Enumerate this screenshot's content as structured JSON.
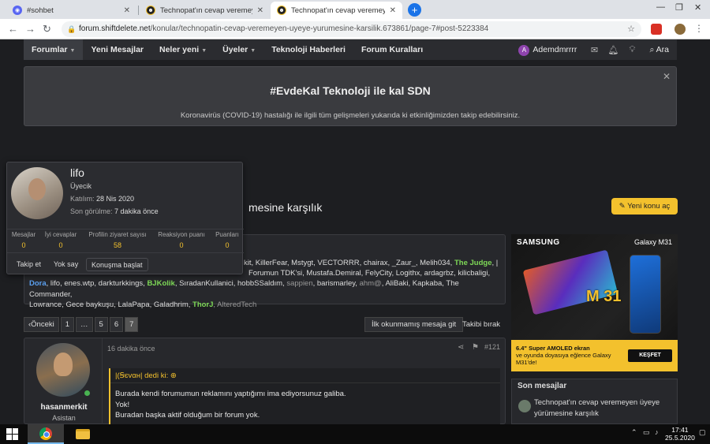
{
  "browser": {
    "tabs": [
      {
        "title": "#sohbet",
        "icon": "discord-icon"
      },
      {
        "title": "Technopat'ın cevap veremeyen ü",
        "icon": "technopat-icon"
      },
      {
        "title": "Technopat'ın cevap veremeyen ü",
        "icon": "technopat-icon",
        "active": true
      }
    ],
    "url_host": "forum.shiftdelete.net",
    "url_path": "/konular/technopatin-cevap-veremeyen-uyeye-yurumesine-karsilik.673861/page-7#post-5223384"
  },
  "nav": {
    "items": [
      "Forumlar",
      "Yeni Mesajlar",
      "Neler yeni",
      "Üyeler",
      "Teknoloji Haberleri",
      "Forum Kuralları"
    ],
    "user_initial": "A",
    "username": "Ademdmrrrr",
    "search": "Ara"
  },
  "notice": {
    "title": "#EvdeKal Teknoloji ile kal SDN",
    "text": "Koronavirüs (COVID-19) hastalığı ile ilgili tüm gelişmeleri yukarıda ki etkinliğimizden takip edebilirsiniz."
  },
  "thread": {
    "title_visible": "mesine karşılık",
    "new_thread": "Yeni konu aç"
  },
  "readers": {
    "line1": "kit, KillerFear, Mstygt, VECTORRR, chairax, _Zaur_, Melih034,",
    "line1_green": "The Judge",
    "line2_a": "Dora",
    "line2_b": ", lifo, enes.wtp, darkturkkings,",
    "line2_green": "BJKolik",
    "line2_c": ", SıradanKullanici, hobbSSaldım,",
    "line2_m": "sappien",
    "line2_d": ", barismarley,",
    "line2_m2": "ahm@",
    "line2_e": ", AliBaki, Kapkaba, The Commander,",
    "line3_a": "Lowrance, Gece baykuşu, LalaPapa, Galadhrim,",
    "line3_green": "ThorJ",
    "line3_m": ", AlteredTech",
    "line0": "Forumun TDK'si, Mustafa.Demiral, FelyCity, Logithx, ardagrbz, kilicbaligi,"
  },
  "pager": {
    "prev": "Önceki",
    "pages": [
      "1",
      "…",
      "5",
      "6",
      "7"
    ],
    "unread": "İlk okunmamış mesaja git",
    "follow": "Takibi bırak"
  },
  "post": {
    "author": "hasanmerkit",
    "rank": "Asistan",
    "time": "16 dakika önce",
    "number": "#121",
    "quote_header": "|(Ꞩєvαн| dedi ki:",
    "lines": [
      "Burada kendi forumumun reklamını yaptığımı ima ediyorsunuz galiba.",
      "Yok!",
      "Buradan başka aktif olduğum bir forum yok."
    ]
  },
  "ad": {
    "brand": "SAMSUNG",
    "model": "Galaxy M31",
    "big": "M 31",
    "line1": "6.4\" Super AMOLED ekran",
    "line2": "ve oyunda doyasıya eğlence Galaxy M31'de!",
    "cta": "KEŞFET"
  },
  "sidebar": {
    "heading": "Son mesajlar",
    "item": "Technopat'ın cevap veremeyen üyeye yürümesine karşılık"
  },
  "popup": {
    "name": "lifo",
    "rank": "Üyecik",
    "joined_label": "Katılım:",
    "joined": "28 Nis 2020",
    "seen_label": "Son görülme:",
    "seen": "7 dakika önce",
    "stats": [
      {
        "label": "Mesajlar",
        "value": "0"
      },
      {
        "label": "İyi cevaplar",
        "value": "0"
      },
      {
        "label": "Profilin ziyaret sayısı",
        "value": "58"
      },
      {
        "label": "Reaksiyon puanı",
        "value": "0"
      },
      {
        "label": "Puanları",
        "value": "0"
      }
    ],
    "follow": "Takip et",
    "ignore": "Yok say",
    "start": "Konuşma başlat"
  },
  "taskbar": {
    "time": "17:41",
    "date": "25.5.2020"
  }
}
